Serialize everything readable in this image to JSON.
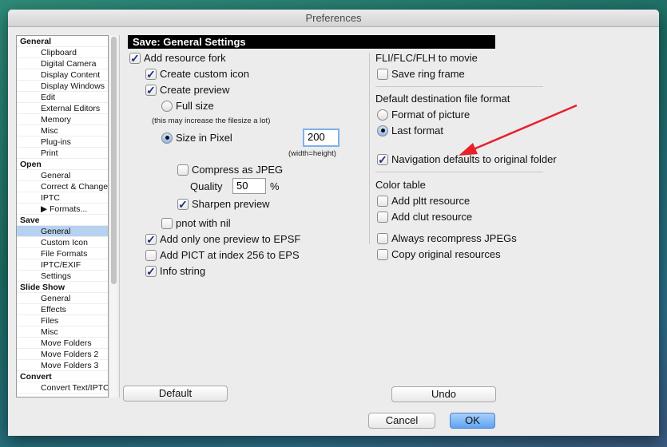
{
  "window": {
    "title": "Preferences"
  },
  "sidebar": {
    "items": [
      {
        "label": "General",
        "type": "header"
      },
      {
        "label": "Clipboard"
      },
      {
        "label": "Digital Camera"
      },
      {
        "label": "Display Content"
      },
      {
        "label": "Display Windows"
      },
      {
        "label": "Edit"
      },
      {
        "label": "External Editors"
      },
      {
        "label": "Memory"
      },
      {
        "label": "Misc"
      },
      {
        "label": "Plug-ins"
      },
      {
        "label": "Print"
      },
      {
        "label": "Open",
        "type": "header"
      },
      {
        "label": "General"
      },
      {
        "label": "Correct & Change"
      },
      {
        "label": "IPTC"
      },
      {
        "label": "▶ Formats..."
      },
      {
        "label": "Save",
        "type": "header"
      },
      {
        "label": "General",
        "selected": true
      },
      {
        "label": "Custom Icon"
      },
      {
        "label": "File Formats"
      },
      {
        "label": "IPTC/EXIF"
      },
      {
        "label": "Settings"
      },
      {
        "label": "Slide Show",
        "type": "header"
      },
      {
        "label": "General"
      },
      {
        "label": "Effects"
      },
      {
        "label": "Files"
      },
      {
        "label": "Misc"
      },
      {
        "label": "Move Folders"
      },
      {
        "label": "Move Folders 2"
      },
      {
        "label": "Move Folders 3"
      },
      {
        "label": "Convert",
        "type": "header"
      },
      {
        "label": "Convert Text/IPTC"
      }
    ]
  },
  "main": {
    "header": "Save: General Settings",
    "add_resource_fork": "Add resource fork",
    "create_custom_icon": "Create custom icon",
    "create_preview": "Create preview",
    "full_size": "Full size",
    "full_size_note": "(this may increase the filesize a lot)",
    "size_in_pixel": "Size in Pixel",
    "pixel_value": "200",
    "pixel_note": "(width=height)",
    "compress_jpeg": "Compress as JPEG",
    "quality_label": "Quality",
    "quality_value": "50",
    "quality_unit": "%",
    "sharpen_preview": "Sharpen preview",
    "pnot_with_nil": "pnot with nil",
    "one_preview_epsf": "Add only one preview to EPSF",
    "add_pict": "Add PICT at index 256 to EPS",
    "info_string": "Info string",
    "fli_heading": "FLI/FLC/FLH to movie",
    "save_ring_frame": "Save ring frame",
    "dest_heading": "Default destination file format",
    "format_of_picture": "Format of picture",
    "last_format": "Last format",
    "nav_defaults": "Navigation defaults to original folder",
    "color_table": "Color table",
    "add_pltt": "Add pltt resource",
    "add_clut": "Add clut resource",
    "always_recompress": "Always recompress JPEGs",
    "copy_original": "Copy original resources"
  },
  "buttons": {
    "default": "Default",
    "undo": "Undo",
    "cancel": "Cancel",
    "ok": "OK"
  },
  "annotation": {
    "arrow_color": "#e8202a"
  },
  "checks": {
    "add_resource_fork": true,
    "create_custom_icon": true,
    "create_preview": true,
    "compress_jpeg": false,
    "sharpen_preview": true,
    "pnot_with_nil": false,
    "one_preview_epsf": true,
    "add_pict": false,
    "info_string": true,
    "save_ring_frame": false,
    "nav_defaults": true,
    "add_pltt": false,
    "add_clut": false,
    "always_recompress": false,
    "copy_original": false
  },
  "radios": {
    "preview_size": "Size in Pixel",
    "dest_format": "Last format"
  }
}
